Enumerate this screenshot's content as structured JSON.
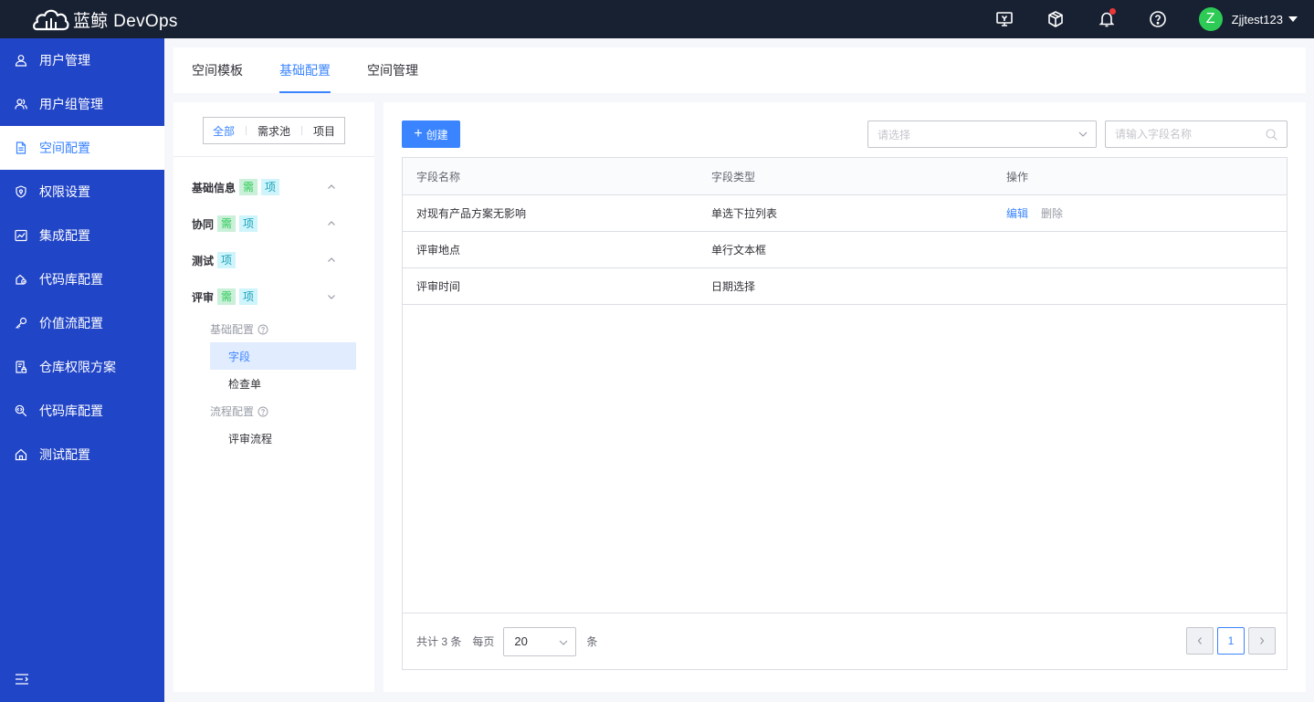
{
  "header": {
    "brand": "蓝鲸 DevOps",
    "username": "Zjjtest123",
    "avatar_letter": "Z",
    "icons": [
      "monitor-icon",
      "package-icon",
      "bell-icon",
      "help-icon"
    ]
  },
  "sidebar": {
    "items": [
      {
        "label": "用户管理",
        "icon": "user-icon"
      },
      {
        "label": "用户组管理",
        "icon": "users-icon"
      },
      {
        "label": "空间配置",
        "icon": "document-icon"
      },
      {
        "label": "权限设置",
        "icon": "shield-icon"
      },
      {
        "label": "集成配置",
        "icon": "chart-icon"
      },
      {
        "label": "代码库配置",
        "icon": "code-repo-icon"
      },
      {
        "label": "价值流配置",
        "icon": "key-icon"
      },
      {
        "label": "仓库权限方案",
        "icon": "file-lock-icon"
      },
      {
        "label": "代码库配置",
        "icon": "search-code-icon"
      },
      {
        "label": "测试配置",
        "icon": "home-icon"
      }
    ],
    "active_index": 2
  },
  "tabs": {
    "items": [
      "空间模板",
      "基础配置",
      "空间管理"
    ],
    "active_index": 1
  },
  "left_panel": {
    "segments": [
      "全部",
      "需求池",
      "项目"
    ],
    "groups": [
      {
        "title": "基础信息",
        "tags": [
          "需",
          "项"
        ],
        "expanded": false
      },
      {
        "title": "协同",
        "tags": [
          "需",
          "项"
        ],
        "expanded": false
      },
      {
        "title": "测试",
        "tags": [
          "项"
        ],
        "expanded": false
      },
      {
        "title": "评审",
        "tags": [
          "需",
          "项"
        ],
        "expanded": true
      }
    ],
    "sub_sections": [
      {
        "title": "基础配置",
        "items": [
          "字段",
          "检查单"
        ]
      },
      {
        "title": "流程配置",
        "items": [
          "评审流程"
        ]
      }
    ],
    "active_sub_item": "字段"
  },
  "toolbar": {
    "create_label": "创建",
    "select_placeholder": "请选择",
    "search_placeholder": "请输入字段名称"
  },
  "table": {
    "columns": [
      "字段名称",
      "字段类型",
      "操作"
    ],
    "rows": [
      {
        "name": "对现有产品方案无影响",
        "type": "单选下拉列表",
        "actions": [
          "编辑",
          "删除"
        ]
      },
      {
        "name": "评审地点",
        "type": "单行文本框",
        "actions": []
      },
      {
        "name": "评审时间",
        "type": "日期选择",
        "actions": []
      }
    ]
  },
  "pagination": {
    "total_prefix": "共计",
    "total": "3",
    "total_suffix": "条",
    "per_page_label": "每页",
    "page_size": "20",
    "page_size_unit": "条",
    "current_page": "1"
  },
  "colors": {
    "topbar": "#182132",
    "sidebar": "#2145c7",
    "primary": "#3a84ff"
  }
}
